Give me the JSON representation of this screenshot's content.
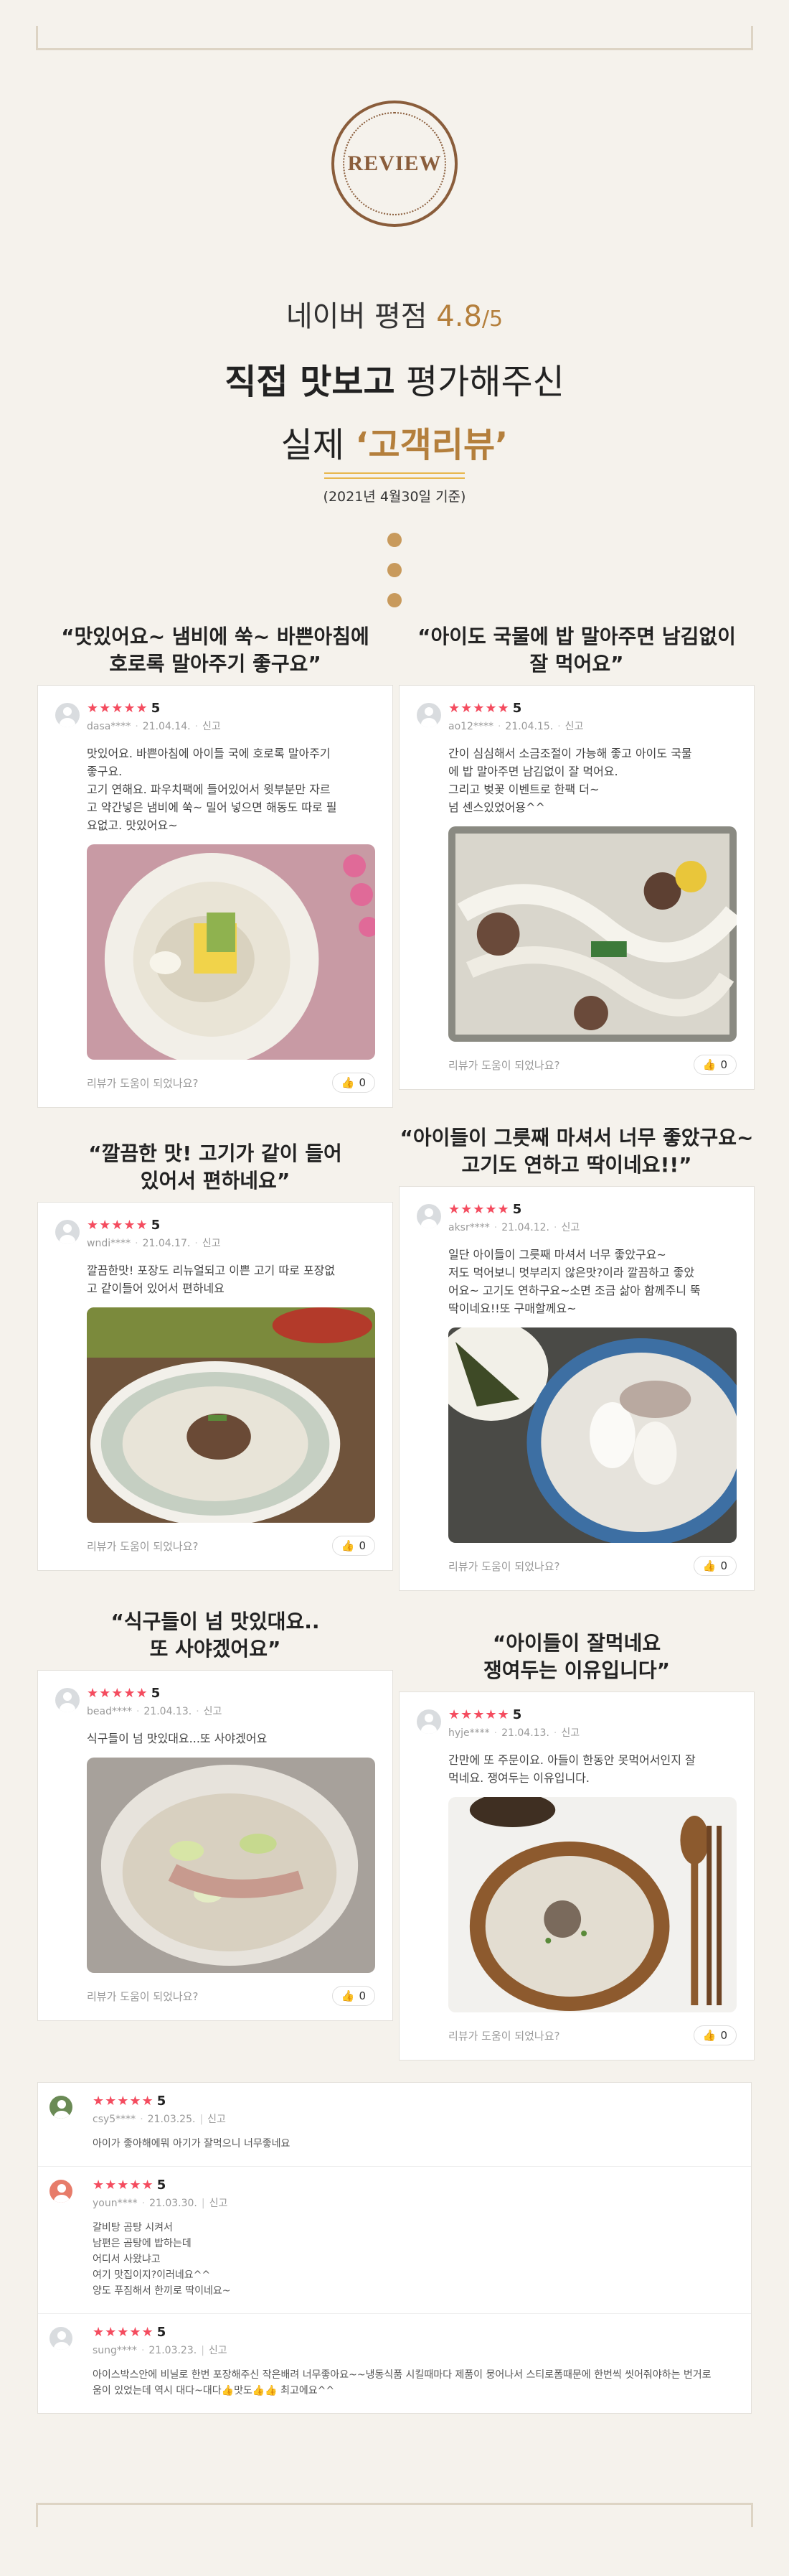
{
  "hero": {
    "stamp_text": "REVIEW",
    "rating_label": "네이버 평점",
    "rating_score": "4.8",
    "rating_max": "/5",
    "line2_bold": "직접 맛보고",
    "line2_rest": "평가해주신",
    "line3_prefix": "실제",
    "line3_quote": "‘고객리뷰’",
    "date_note": "(2021년 4월30일 기준)"
  },
  "helpful_label": "리뷰가 도움이 되었나요?",
  "like_count": "0",
  "report_label": "신고",
  "reviews": [
    {
      "title": "“맛있어요~ 냄비에 쑥~ 바쁜아침에\n호로록 말아주기 좋구요”",
      "stars": "★★★★★",
      "score": "5",
      "user": "dasa****",
      "date": "21.04.14.",
      "text": "맛있어요. 바쁜아침에 아이들 국에 호로록 말아주기\n좋구요.\n고기 연해요. 파우치팩에 들어있어서 윗부분만 자르\n고 약간넣은 냄비에 쑥~ 밀어 넣으면 해동도 따로 필\n요없고. 맛있어요~",
      "photo": "soup-bowl-egg-garnish"
    },
    {
      "title": "“아이도 국물에 밥 말아주면 남김없이\n잘 먹어요”",
      "stars": "★★★★★",
      "score": "5",
      "user": "ao12****",
      "date": "21.04.15.",
      "text": "간이 심심해서 소금조절이 가능해 좋고 아이도 국물\n에 밥 말아주면 남김없이 잘 먹어요.\n그리고 벚꽃 이벤트로 한팩 더~\n넘 센스있었어용^^",
      "photo": "noodle-beef-soup"
    },
    {
      "title": "“깔끔한 맛! 고기가 같이 들어\n있어서 편하네요”",
      "stars": "★★★★★",
      "score": "5",
      "user": "wndi****",
      "date": "21.04.17.",
      "text": "깔끔한맛! 포장도 리뉴얼되고 이쁜 고기 따로 포장없\n고 같이들어 있어서 편하네요",
      "photo": "beef-bone-soup-bowl"
    },
    {
      "title": "“아이들이 그릇째 마셔서 너무 좋았구요~\n고기도 연하고 딱이네요!!”",
      "stars": "★★★★★",
      "score": "5",
      "user": "aksr****",
      "date": "21.04.12.",
      "text": "일단 아이들이 그릇째 마셔서 너무 좋았구요~\n저도 먹어보니 멋부리지 않은맛?이라 깔끔하고 좋았\n어요~ 고기도 연하구요~소면 조금 삶아 함께주니 뚝\n딱이네요!!또 구매할께요~",
      "photo": "rice-cake-soup-seaweed"
    },
    {
      "title": "“식구들이 넘 맛있대요..\n또 사야겠어요”",
      "stars": "★★★★★",
      "score": "5",
      "user": "bead****",
      "date": "21.04.13.",
      "text": "식구들이 넘 맛있대요...또 사야겠어요",
      "photo": "soup-green-onion"
    },
    {
      "title": "“아이들이 잘먹네요\n쟁여두는 이유입니다”",
      "stars": "★★★★★",
      "score": "5",
      "user": "hyje****",
      "date": "21.04.13.",
      "text": "간만에 또 주문이요. 아들이 한동안 못먹어서인지 잘\n먹네요. 쟁여두는 이유입니다.",
      "photo": "soup-with-spoon-chopsticks"
    }
  ],
  "list_reviews": [
    {
      "stars": "★★★★★",
      "score": "5",
      "user": "csy5****",
      "date": "21.03.25.",
      "text": "아이가 좋아해에뭐 아기가 잘먹으니 너무좋네요"
    },
    {
      "stars": "★★★★★",
      "score": "5",
      "user": "youn****",
      "date": "21.03.30.",
      "text": "갈비탕 곰탕 시켜서\n남편은 곰탕에 밥하는데\n어디서 사왔냐고\n여기 맛집이지?이러네요^^\n양도 푸짐해서 한끼로 딱이네요~"
    },
    {
      "stars": "★★★★★",
      "score": "5",
      "user": "sung****",
      "date": "21.03.23.",
      "text": "아이스박스안에 비닐로 한번 포장해주신 작은배려 너무좋아요~~냉동식품 시킬때마다 제품이 뭉어나서 스티로폼때문에 한번씩 씻어줘야하는 번거로\n움이 있었는데 역시 대다~대다👍맛도👍👍 최고에요^^"
    }
  ]
}
